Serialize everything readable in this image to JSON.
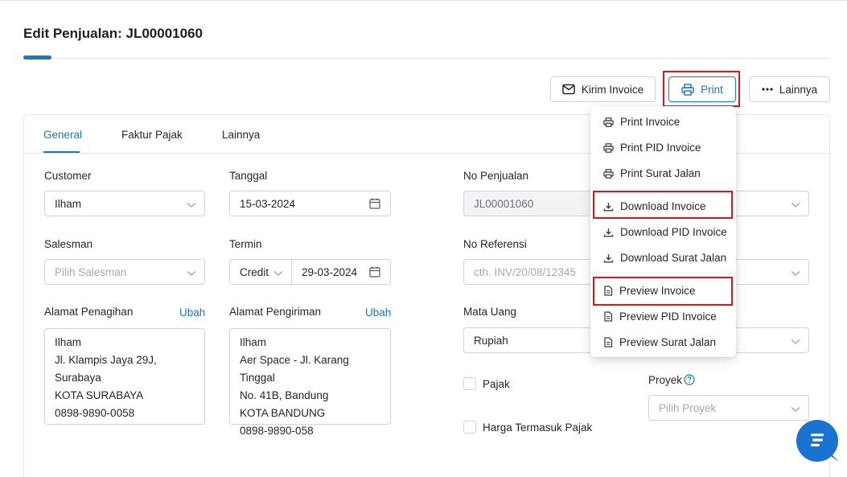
{
  "page": {
    "title": "Edit Penjualan: JL00001060"
  },
  "actions": {
    "kirim_invoice": "Kirim Invoice",
    "print": "Print",
    "lainnya": "Lainnya"
  },
  "print_menu": {
    "items": [
      {
        "label": "Print Invoice",
        "icon": "printer-icon"
      },
      {
        "label": "Print PID Invoice",
        "icon": "printer-icon"
      },
      {
        "label": "Print Surat Jalan",
        "icon": "printer-icon"
      },
      {
        "label": "Download Invoice",
        "icon": "download-icon"
      },
      {
        "label": "Download PID Invoice",
        "icon": "download-icon"
      },
      {
        "label": "Download Surat Jalan",
        "icon": "download-icon"
      },
      {
        "label": "Preview Invoice",
        "icon": "document-icon"
      },
      {
        "label": "Preview PID Invoice",
        "icon": "document-icon"
      },
      {
        "label": "Preview Surat Jalan",
        "icon": "document-icon"
      }
    ]
  },
  "tabs": [
    {
      "label": "General",
      "active": true
    },
    {
      "label": "Faktur Pajak",
      "active": false
    },
    {
      "label": "Lainnya",
      "active": false
    }
  ],
  "form": {
    "customer": {
      "label": "Customer",
      "value": "Ilham"
    },
    "tanggal": {
      "label": "Tanggal",
      "value": "15-03-2024"
    },
    "no_penjualan": {
      "label": "No Penjualan",
      "value": "JL00001060"
    },
    "salesman": {
      "label": "Salesman",
      "placeholder": "Pilih Salesman"
    },
    "termin": {
      "label": "Termin",
      "type": "Credit",
      "date": "29-03-2024"
    },
    "no_referensi": {
      "label": "No Referensi",
      "placeholder": "cth. INV/20/08/12345"
    },
    "alamat_penagihan": {
      "label": "Alamat Penagihan",
      "edit": "Ubah",
      "lines": [
        "Ilham",
        "Jl. Klampis Jaya 29J,",
        "Surabaya",
        "KOTA SURABAYA",
        "0898-9890-0058"
      ]
    },
    "alamat_pengiriman": {
      "label": "Alamat Pengiriman",
      "edit": "Ubah",
      "lines": [
        "Ilham",
        "Aer Space - Jl. Karang Tinggal",
        "No. 41B, Bandung",
        "KOTA BANDUNG",
        "0898-9890-058"
      ]
    },
    "mata_uang": {
      "label": "Mata Uang",
      "value": "Rupiah"
    },
    "pajak": {
      "label": "Pajak"
    },
    "harga_termasuk_pajak": {
      "label": "Harga Termasuk Pajak"
    },
    "proyek": {
      "label": "Proyek",
      "placeholder": "Pilih Proyek"
    }
  },
  "colors": {
    "primary": "#1677d2",
    "highlight": "#e0161b",
    "chat": "#1a73d1"
  }
}
